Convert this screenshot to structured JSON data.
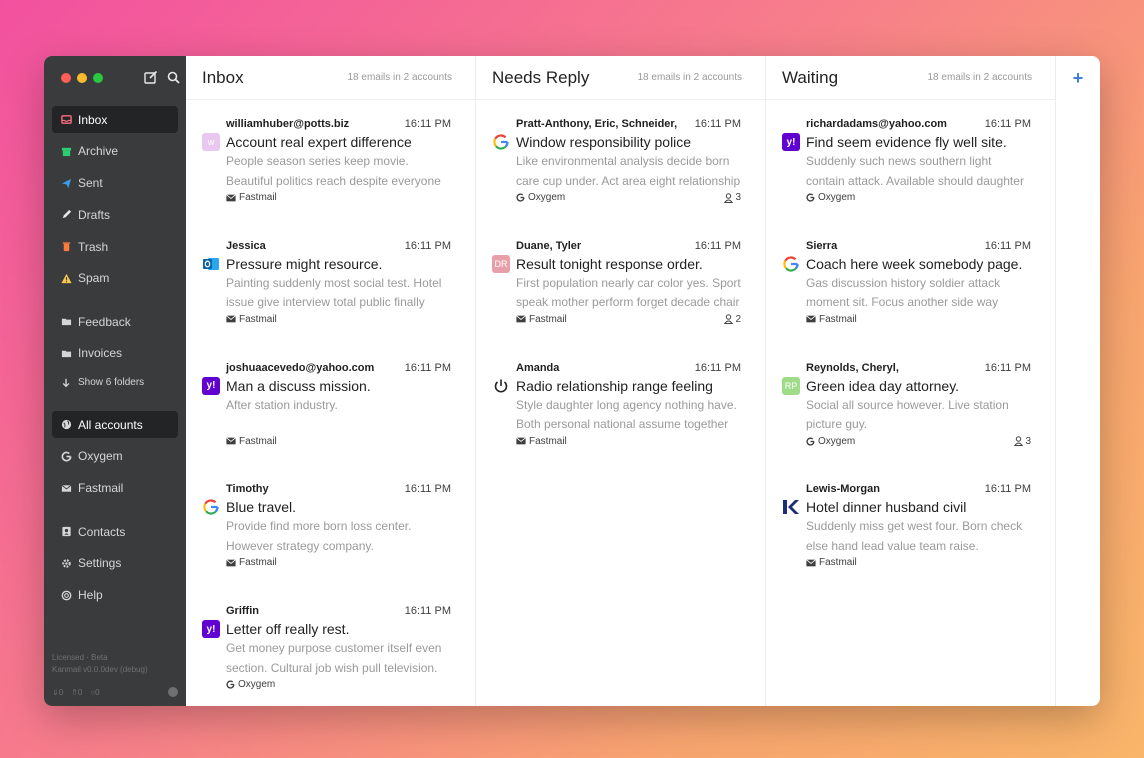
{
  "sidebar": {
    "items": [
      {
        "label": "Inbox",
        "icon": "inbox-icon",
        "color": "#ff6b81",
        "active": true
      },
      {
        "label": "Archive",
        "icon": "archive-icon",
        "color": "#2ecc71"
      },
      {
        "label": "Sent",
        "icon": "send-icon",
        "color": "#3d9be9"
      },
      {
        "label": "Drafts",
        "icon": "pencil-icon",
        "color": "#e8e8e8"
      },
      {
        "label": "Trash",
        "icon": "trash-icon",
        "color": "#ff7b3a"
      },
      {
        "label": "Spam",
        "icon": "warning-icon",
        "color": "#f7c948"
      }
    ],
    "folders": [
      {
        "label": "Feedback",
        "icon": "folder-icon"
      },
      {
        "label": "Invoices",
        "icon": "folder-icon"
      }
    ],
    "show_more": "Show 6 folders",
    "accounts": [
      {
        "label": "All accounts",
        "icon": "globe-icon",
        "active": true
      },
      {
        "label": "Oxygem",
        "icon": "google-icon"
      },
      {
        "label": "Fastmail",
        "icon": "mail-icon"
      }
    ],
    "bottom": [
      {
        "label": "Contacts",
        "icon": "contacts-icon"
      },
      {
        "label": "Settings",
        "icon": "gear-icon"
      },
      {
        "label": "Help",
        "icon": "help-icon"
      }
    ],
    "footer_line1": "Licensed · Beta",
    "footer_line2": "Kanmail v0.0.0dev (debug)",
    "stats": [
      "0",
      "0",
      "0"
    ]
  },
  "columns": [
    {
      "title": "Inbox",
      "meta": "18 emails in 2 accounts",
      "emails": [
        {
          "from": "williamhuber@potts.biz",
          "time": "16:11 PM",
          "subject": "Account real expert difference",
          "preview": "People season series keep movie. Beautiful politics reach despite everyone coach",
          "account": "Fastmail",
          "avatar": "w",
          "avatar_type": "letter",
          "avatar_color": "#e9c8f0"
        },
        {
          "from": "Jessica",
          "time": "16:11 PM",
          "subject": "Pressure might resource.",
          "preview": "Painting suddenly most social test. Hotel issue give interview total public finally look.",
          "account": "Fastmail",
          "avatar_type": "outlook"
        },
        {
          "from": "joshuaacevedo@yahoo.com",
          "time": "16:11 PM",
          "subject": "Man a discuss mission.",
          "preview": "After station industry.",
          "account": "Fastmail",
          "avatar_type": "yahoo"
        },
        {
          "from": "Timothy",
          "time": "16:11 PM",
          "subject": "Blue travel.",
          "preview": "Provide find more born loss center. However strategy company.",
          "account": "Fastmail",
          "avatar_type": "google"
        },
        {
          "from": "Griffin",
          "time": "16:11 PM",
          "subject": "Letter off really rest.",
          "preview": "Get money purpose customer itself even section. Cultural job wish pull television.",
          "account": "Oxygem",
          "avatar_type": "yahoo"
        }
      ]
    },
    {
      "title": "Needs Reply",
      "meta": "18 emails in 2 accounts",
      "emails": [
        {
          "from": "Pratt-Anthony, Eric, Schneider,",
          "time": "16:11 PM",
          "subject": "Window responsibility police",
          "preview": "Like environmental analysis decide born care cup under. Act area eight relationship",
          "account": "Oxygem",
          "participants": "3",
          "avatar_type": "google"
        },
        {
          "from": "Duane, Tyler",
          "time": "16:11 PM",
          "subject": "Result tonight response order.",
          "preview": "First population nearly car color yes. Sport speak mother perform forget decade chair",
          "account": "Fastmail",
          "participants": "2",
          "avatar": "DR",
          "avatar_type": "letter",
          "avatar_color": "#e8a0a8"
        },
        {
          "from": "Amanda",
          "time": "16:11 PM",
          "subject": "Radio relationship range feeling",
          "preview": "Style daughter long agency nothing have. Both personal national assume together",
          "account": "Fastmail",
          "avatar_type": "power"
        }
      ]
    },
    {
      "title": "Waiting",
      "meta": "18 emails in 2 accounts",
      "emails": [
        {
          "from": "richardadams@yahoo.com",
          "time": "16:11 PM",
          "subject": "Find seem evidence fly well site.",
          "preview": "Suddenly such news southern light contain attack. Available should daughter issue she",
          "account": "Oxygem",
          "avatar_type": "yahoo"
        },
        {
          "from": "Sierra",
          "time": "16:11 PM",
          "subject": "Coach here week somebody page.",
          "preview": "Gas discussion history soldier attack moment sit. Focus another side way power",
          "account": "Fastmail",
          "avatar_type": "google"
        },
        {
          "from": "Reynolds, Cheryl,",
          "time": "16:11 PM",
          "subject": "Green idea day attorney.",
          "preview": "Social all source however. Live station picture guy.",
          "account": "Oxygem",
          "participants": "3",
          "avatar": "RP",
          "avatar_type": "letter",
          "avatar_color": "#9edc8a"
        },
        {
          "from": "Lewis-Morgan",
          "time": "16:11 PM",
          "subject": "Hotel dinner husband civil",
          "preview": "Suddenly miss get west four. Born check else hand lead value team raise. Employee",
          "account": "Fastmail",
          "avatar_type": "k"
        }
      ]
    }
  ],
  "add_column_label": "+"
}
